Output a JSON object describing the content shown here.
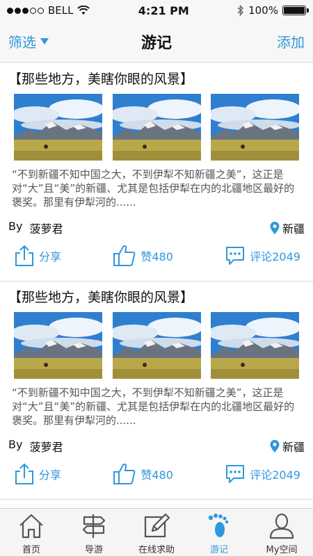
{
  "status": {
    "carrier": "BELL",
    "time": "4:21 PM",
    "battery": "100%"
  },
  "nav": {
    "filter_label": "筛选",
    "title": "游记",
    "add_label": "添加"
  },
  "posts": [
    {
      "title": "【那些地方，美瞎你眼的风景】",
      "excerpt": "“不到新疆不知中国之大，不到伊犁不知新疆之美”，这正是对“大”且“美”的新疆、尤其是包括伊犁在内的北疆地区最好的褒奖。那里有伊犁河的......",
      "author_prefix": "By",
      "author": "菠萝君",
      "location": "新疆",
      "share_label": "分享",
      "like_label": "赞480",
      "comment_label": "评论2049"
    },
    {
      "title": "【那些地方，美瞎你眼的风景】",
      "excerpt": "“不到新疆不知中国之大，不到伊犁不知新疆之美”，这正是对“大”且“美”的新疆、尤其是包括伊犁在内的北疆地区最好的褒奖。那里有伊犁河的......",
      "author_prefix": "By",
      "author": "菠萝君",
      "location": "新疆",
      "share_label": "分享",
      "like_label": "赞480",
      "comment_label": "评论2049"
    }
  ],
  "tabs": [
    {
      "label": "首页",
      "icon": "home-icon"
    },
    {
      "label": "导游",
      "icon": "signpost-icon"
    },
    {
      "label": "在线求助",
      "icon": "pencil-icon"
    },
    {
      "label": "游记",
      "icon": "footprint-icon",
      "active": true
    },
    {
      "label": "My空间",
      "icon": "person-icon"
    }
  ],
  "colors": {
    "accent": "#2f97dc",
    "bar_bg": "#f7f7f7"
  }
}
